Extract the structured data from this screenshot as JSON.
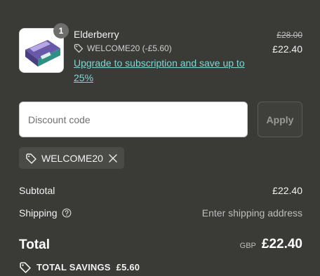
{
  "line_item": {
    "image_icon": "product-package-icon",
    "quantity": "1",
    "name": "Elderberry",
    "discount_label": "WELCOME20 (-£5.60)",
    "upsell_link": "Upgrade to subscription and save up to 25%",
    "original_price": "£28.00",
    "price": "£22.40"
  },
  "discount": {
    "placeholder": "Discount code",
    "apply_label": "Apply",
    "applied_code": "WELCOME20"
  },
  "summary": {
    "subtotal_label": "Subtotal",
    "subtotal_value": "£22.40",
    "shipping_label": "Shipping",
    "shipping_value": "Enter shipping address",
    "total_label": "Total",
    "currency": "GBP",
    "total_value": "£22.40",
    "savings_label": "TOTAL SAVINGS",
    "savings_value": "£5.60"
  },
  "colors": {
    "background": "#3a3b37",
    "link": "#7fd6d3",
    "text": "#f2f2f2",
    "muted": "#bdbdbd"
  }
}
